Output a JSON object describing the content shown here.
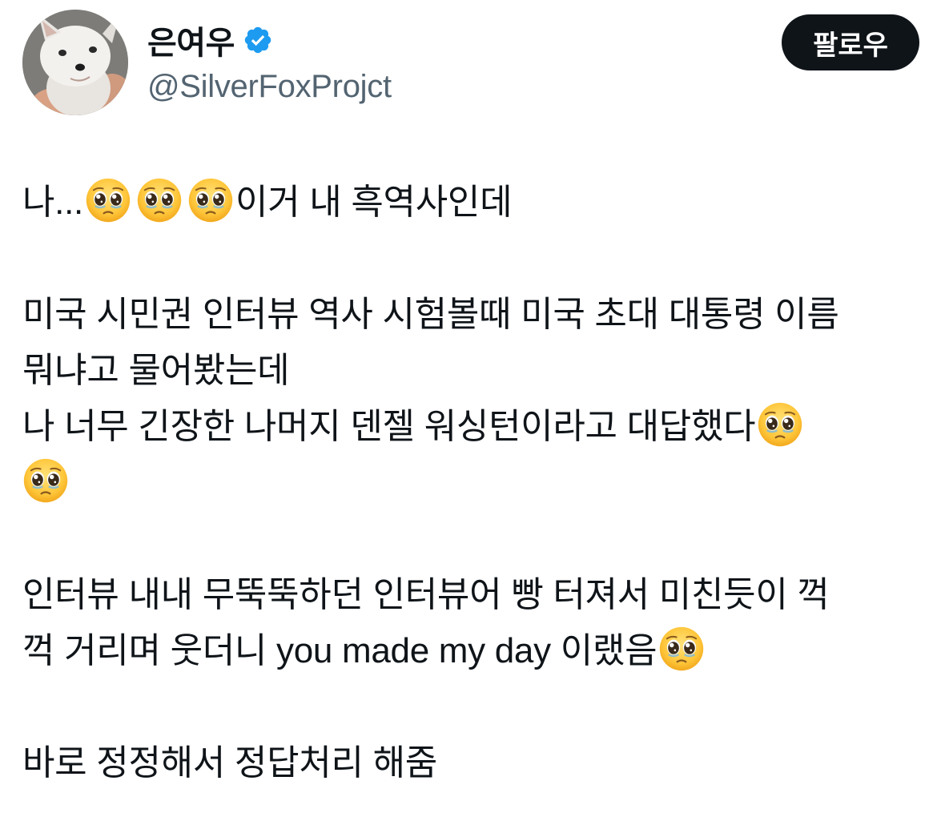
{
  "author": {
    "display_name": "은여우",
    "handle": "@SilverFoxProjct",
    "verified": true,
    "avatar": "fox-kit-photo"
  },
  "actions": {
    "follow_label": "팔로우"
  },
  "colors": {
    "text": "#0f1419",
    "secondary_text": "#536471",
    "verified_blue": "#1d9bf0",
    "button_bg": "#0f1419"
  },
  "tweet": {
    "line1_a": "나...",
    "line1_b": "이거 내 흑역사인데",
    "line2": "미국 시민권 인터뷰 역사 시험볼때 미국 초대 대통령 이름",
    "line3": "뭐냐고 물어봤는데",
    "line4": "나 너무 긴장한 나머지 덴젤 워싱턴이라고 대답했다",
    "line6": "인터뷰 내내 무뚝뚝하던 인터뷰어 빵 터져서 미친듯이 꺽",
    "line7": "꺽 거리며 웃더니 you made my day 이랬음",
    "line8": "바로 정정해서 정답처리 해줌",
    "emoji": "pleading-face-emoji"
  }
}
